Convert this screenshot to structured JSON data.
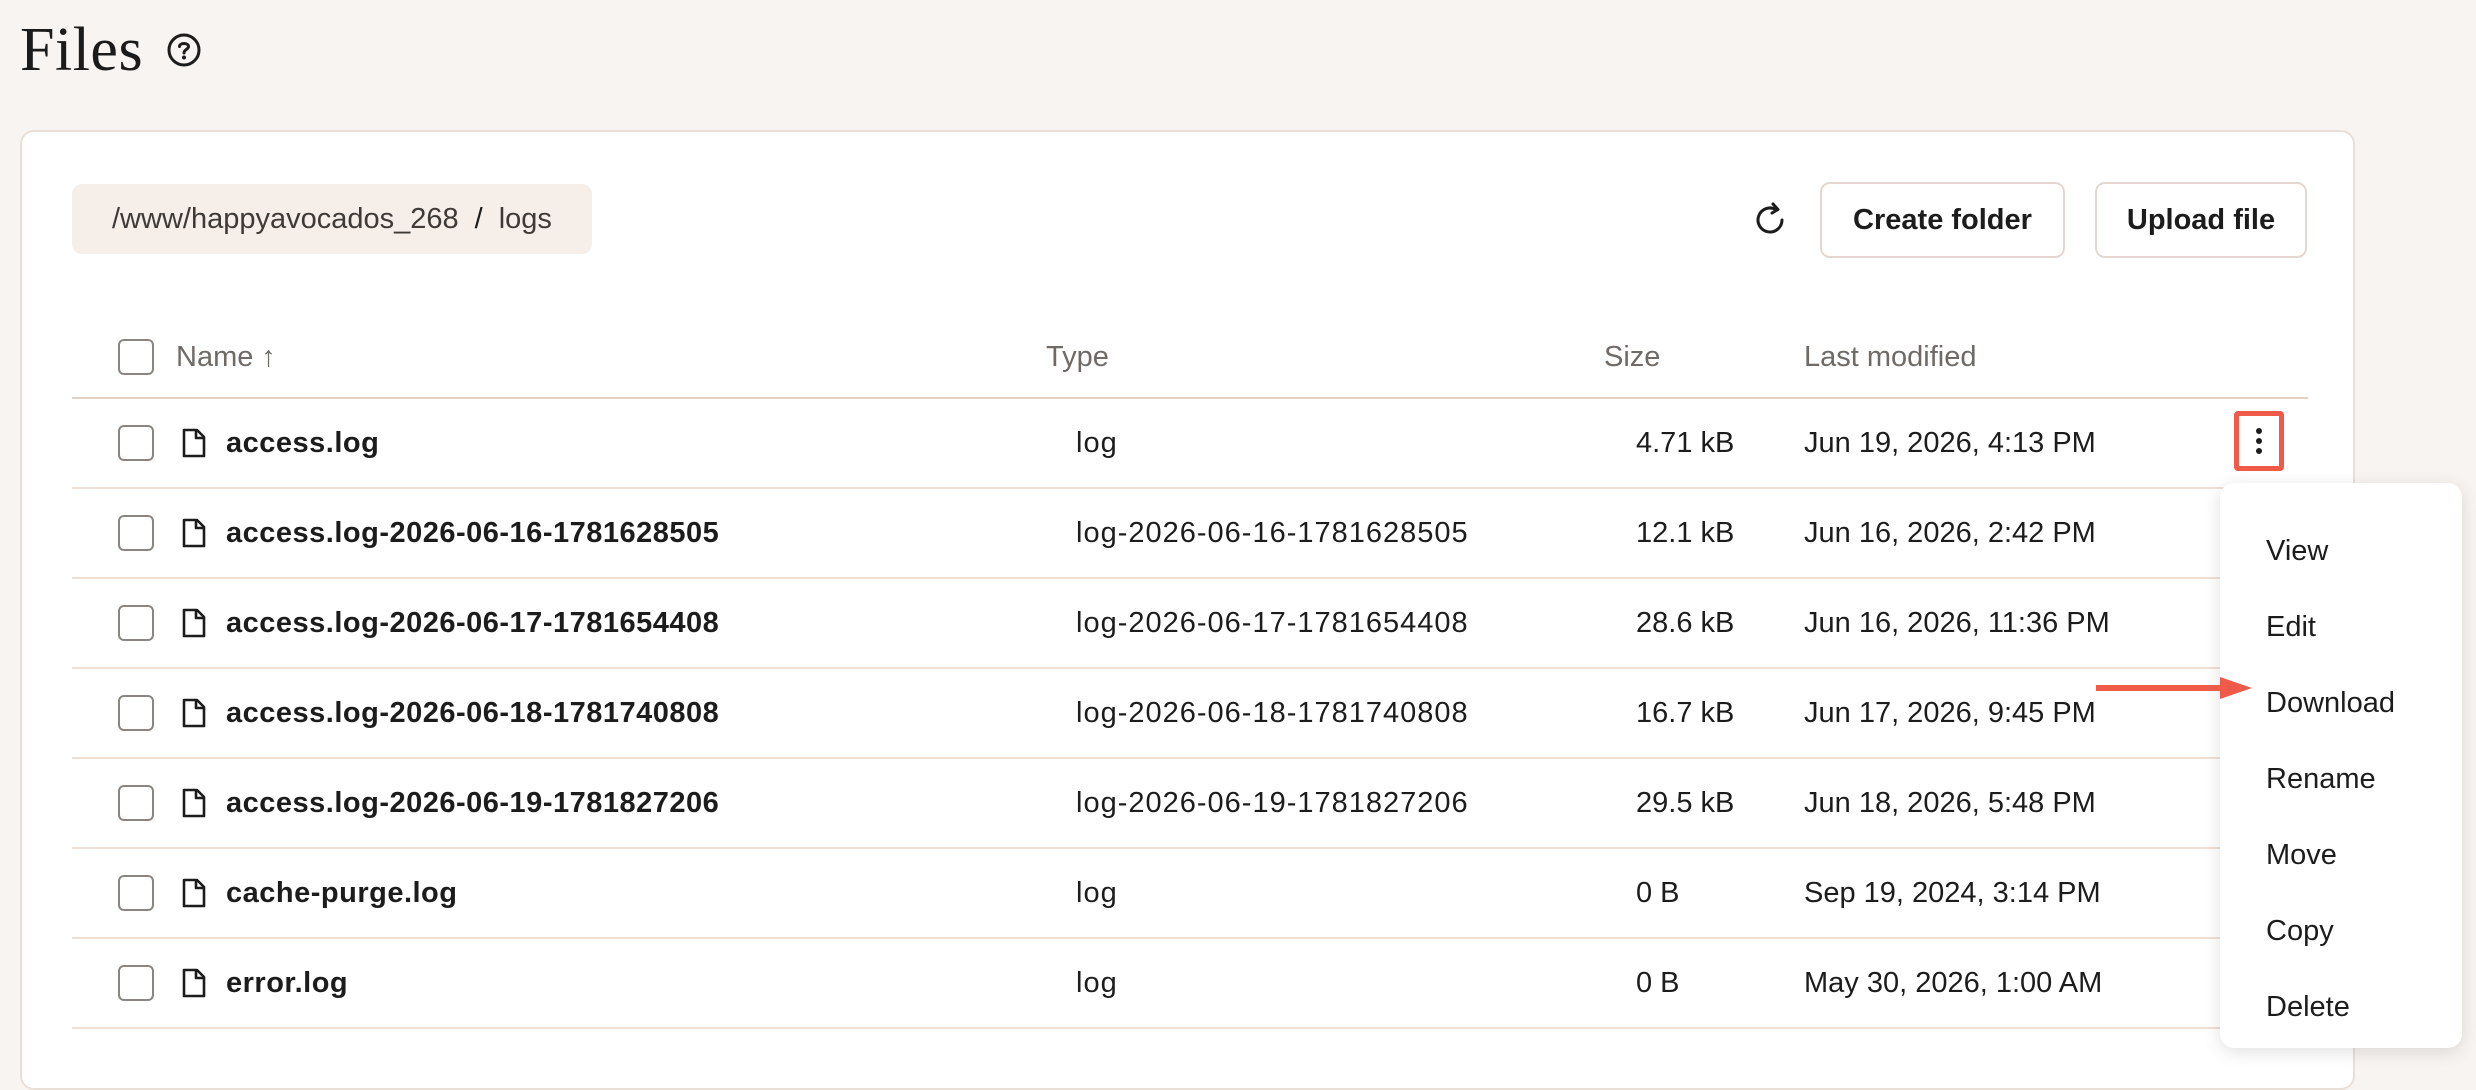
{
  "page": {
    "title": "Files"
  },
  "breadcrumb": {
    "root": "/www/happyavocados_268",
    "separator": "/",
    "current": "logs"
  },
  "toolbar": {
    "create_folder": "Create folder",
    "upload_file": "Upload file"
  },
  "table": {
    "headers": {
      "name": "Name",
      "sort_indicator": "↑",
      "type": "Type",
      "size": "Size",
      "last_modified": "Last modified"
    },
    "rows": [
      {
        "name": "access.log",
        "type": "log",
        "size": "4.71 kB",
        "modified": "Jun 19, 2026, 4:13 PM"
      },
      {
        "name": "access.log-2026-06-16-1781628505",
        "type": "log-2026-06-16-1781628505",
        "size": "12.1 kB",
        "modified": "Jun 16, 2026, 2:42 PM"
      },
      {
        "name": "access.log-2026-06-17-1781654408",
        "type": "log-2026-06-17-1781654408",
        "size": "28.6 kB",
        "modified": "Jun 16, 2026, 11:36 PM"
      },
      {
        "name": "access.log-2026-06-18-1781740808",
        "type": "log-2026-06-18-1781740808",
        "size": "16.7 kB",
        "modified": "Jun 17, 2026, 9:45 PM"
      },
      {
        "name": "access.log-2026-06-19-1781827206",
        "type": "log-2026-06-19-1781827206",
        "size": "29.5 kB",
        "modified": "Jun 18, 2026, 5:48 PM"
      },
      {
        "name": "cache-purge.log",
        "type": "log",
        "size": "0 B",
        "modified": "Sep 19, 2024, 3:14 PM"
      },
      {
        "name": "error.log",
        "type": "log",
        "size": "0 B",
        "modified": "May 30, 2026, 1:00 AM"
      }
    ]
  },
  "context_menu": {
    "items": [
      "View",
      "Edit",
      "Download",
      "Rename",
      "Move",
      "Copy",
      "Delete"
    ]
  },
  "colors": {
    "highlight": "#f05a48",
    "background": "#f8f4f1",
    "card": "#ffffff"
  }
}
